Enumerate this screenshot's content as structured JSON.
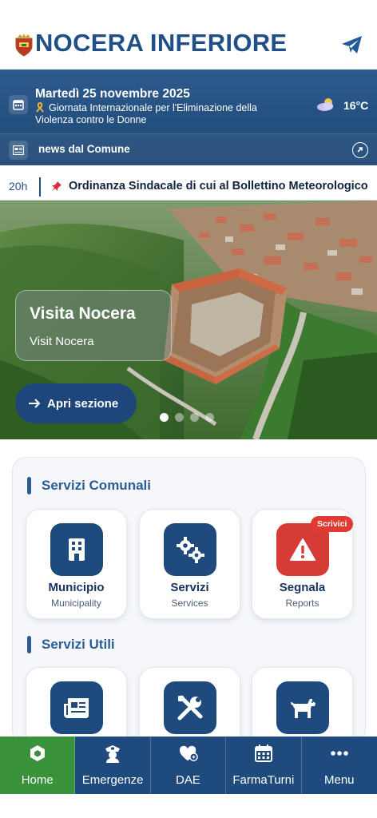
{
  "header": {
    "title": "NOCERA INFERIORE",
    "crest_icon": "city-crest-icon",
    "send_icon": "telegram-send-icon",
    "brand_color": "#1f4f86"
  },
  "info": {
    "date": "Martedì 25 novembre 2025",
    "event": "Giornata Internazionale per l'Eliminazione della Violenza contro le Donne",
    "temperature": "16°C",
    "weather_icon": "partly-cloudy-icon",
    "news_label": "news dal Comune"
  },
  "ticker": {
    "time": "20h",
    "text": "Ordinanza Sindacale di cui al Bollettino Meteorologico"
  },
  "hero": {
    "title": "Visita Nocera",
    "subtitle": "Visit Nocera",
    "button": "Apri sezione",
    "slide_count": 4,
    "active_slide": 1
  },
  "services": {
    "comunali_title": "Servizi Comunali",
    "comunali": [
      {
        "label": "Municipio",
        "sub": "Municipality",
        "icon": "building-icon"
      },
      {
        "label": "Servizi",
        "sub": "Services",
        "icon": "gears-icon"
      },
      {
        "label": "Segnala",
        "sub": "Reports",
        "icon": "warning-icon",
        "badge": "Scrivici"
      }
    ],
    "utili_title": "Servizi Utili",
    "utili_icons": [
      "newspaper-icon",
      "tools-icon",
      "dog-icon"
    ]
  },
  "nav": {
    "items": [
      {
        "label": "Home",
        "icon": "home-icon",
        "active": true
      },
      {
        "label": "Emergenze",
        "icon": "police-icon"
      },
      {
        "label": "DAE",
        "icon": "defibrillator-heart-icon"
      },
      {
        "label": "FarmaTurni",
        "icon": "calendar-icon"
      },
      {
        "label": "Menu",
        "icon": "more-dots-icon"
      }
    ],
    "active_color": "#39913a",
    "bar_color": "#1f4a7d"
  }
}
